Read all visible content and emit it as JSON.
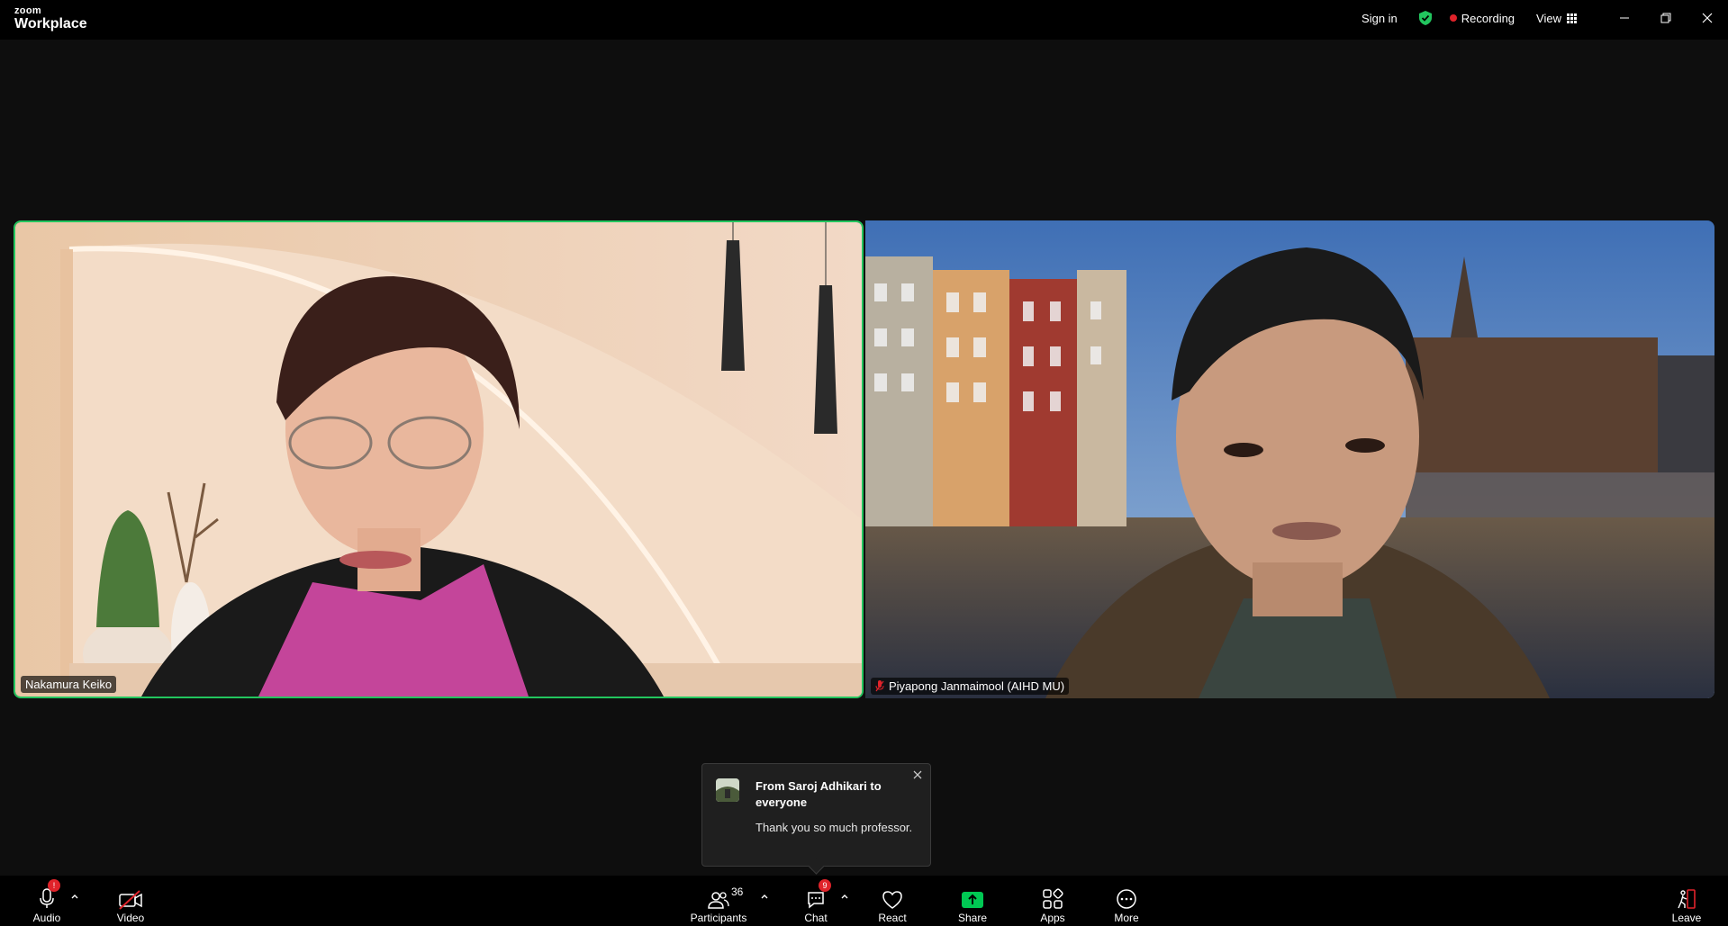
{
  "titlebar": {
    "brand": "zoom",
    "product": "Workplace",
    "sign_in": "Sign in",
    "recording": "Recording",
    "view": "View"
  },
  "tiles": [
    {
      "name": "Nakamura Keiko",
      "active_speaker": true
    },
    {
      "name": "Piyapong Janmaimool (AIHD MU)",
      "muted": true
    }
  ],
  "chat_toast": {
    "from": "From Saroj Adhikari to everyone",
    "message": "Thank you so much professor."
  },
  "toolbar": {
    "audio": "Audio",
    "video": "Video",
    "participants": "Participants",
    "participants_count": "36",
    "chat": "Chat",
    "chat_badge": "9",
    "react": "React",
    "share": "Share",
    "apps": "Apps",
    "more": "More",
    "leave": "Leave",
    "audio_badge": "!"
  },
  "colors": {
    "active_speaker_border": "#22c55e",
    "recording_dot": "#e0232a",
    "share_green": "#00c853",
    "badge_red": "#e0232a"
  }
}
